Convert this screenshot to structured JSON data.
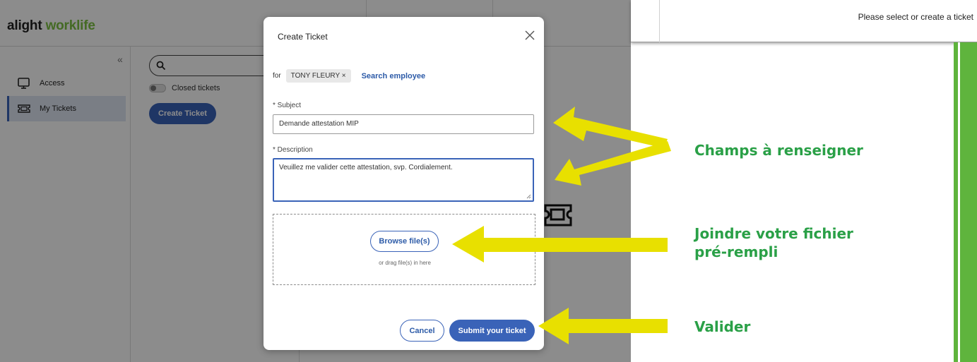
{
  "app": {
    "logo_part1": "alight",
    "logo_part2": "worklife",
    "collapse_glyph": "«",
    "nav": [
      {
        "label": "Access",
        "icon": "monitor-icon",
        "active": false
      },
      {
        "label": "My Tickets",
        "icon": "ticket-icon",
        "active": true
      }
    ],
    "search_icon": "search-icon",
    "closed_tickets_label": "Closed tickets",
    "create_ticket_label": "Create Ticket"
  },
  "right_panel": {
    "status_text": "Please select or create a ticket"
  },
  "modal": {
    "title": "Create Ticket",
    "close_icon": "close-icon",
    "for_label": "for",
    "employee_chip": "TONY FLEURY ×",
    "search_employee_label": "Search employee",
    "subject_label": "* Subject",
    "subject_value": "Demande attestation MIP",
    "description_label": "* Description",
    "description_value": "Veuillez me valider cette attestation, svp. Cordialement.",
    "browse_label": "Browse file(s)",
    "drag_hint": "or drag file(s) in here",
    "cancel_label": "Cancel",
    "submit_label": "Submit your ticket"
  },
  "annotations": {
    "fields_note": "Champs à renseigner",
    "file_note_line1": "Joindre votre fichier",
    "file_note_line2": "pré-rempli",
    "validate_note": "Valider",
    "arrow_color": "#e8e000",
    "text_color": "#2aa047"
  },
  "colors": {
    "accent": "#3a63b8",
    "brand_green": "#7cc242",
    "side_green": "#5fb43d"
  }
}
